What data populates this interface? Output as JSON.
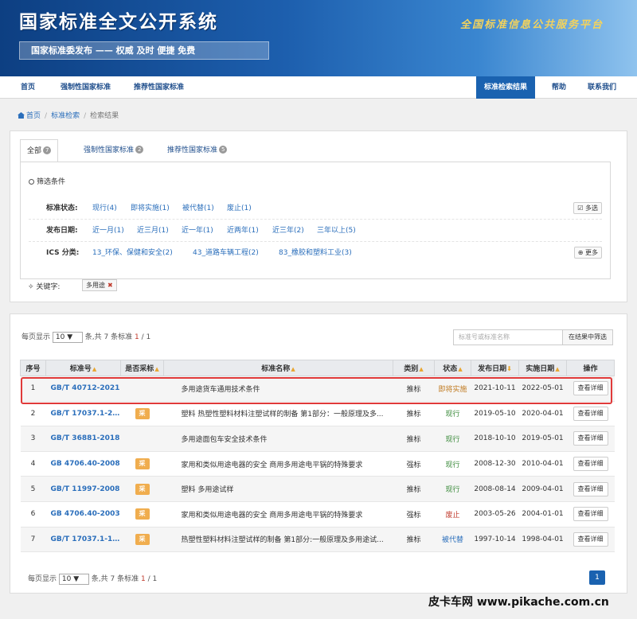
{
  "banner": {
    "title": "国家标准全文公开系统",
    "subtitle": "国家标准委发布  ——  权威  及时  便捷  免费",
    "slogan": "全国标准信息公共服务平台"
  },
  "nav": {
    "home": "首页",
    "mandatory": "强制性国家标准",
    "recommended": "推荐性国家标准",
    "search_results": "标准检索结果",
    "help": "帮助",
    "contact": "联系我们"
  },
  "breadcrumb": [
    "首页",
    "标准检索",
    "检索结果"
  ],
  "tabs": [
    {
      "label": "全部",
      "count": "7"
    },
    {
      "label": "强制性国家标准",
      "count": "2"
    },
    {
      "label": "推荐性国家标准",
      "count": "5"
    }
  ],
  "filters": {
    "title": "筛选条件",
    "status": {
      "label": "标准状态:",
      "options": [
        "现行(4)",
        "即将实施(1)",
        "被代替(1)",
        "废止(1)"
      ],
      "button": "多选"
    },
    "date": {
      "label": "发布日期:",
      "options": [
        "近一月(1)",
        "近三月(1)",
        "近一年(1)",
        "近两年(1)",
        "近三年(2)",
        "三年以上(5)"
      ]
    },
    "ics": {
      "label": "ICS 分类:",
      "options": [
        "13_环保、保健和安全(2)",
        "43_道路车辆工程(2)",
        "83_橡胶和塑料工业(3)"
      ],
      "button": "更多"
    }
  },
  "keyword": {
    "label": "关键字:",
    "value": "多用途",
    "remove": "✖"
  },
  "pagination": {
    "per_page_prefix": "每页显示",
    "per_page_value": "10",
    "per_page_suffix": "条,共 7 条标准",
    "current": "1",
    "total": "/ 1",
    "page_button": "1"
  },
  "search": {
    "placeholder": "标准号或标准名称",
    "button": "在结果中筛选"
  },
  "table": {
    "headers": {
      "no": "序号",
      "code": "标准号",
      "adopt": "是否采标",
      "name": "标准名称",
      "category": "类别",
      "status": "状态",
      "publish": "发布日期",
      "implement": "实施日期",
      "action": "操作"
    },
    "adopt_badge": "采",
    "detail_label": "查看详细",
    "rows": [
      {
        "no": "1",
        "code": "GB/T 40712-2021",
        "adopt": false,
        "name": "多用途货车通用技术条件",
        "category": "推标",
        "status": "即将实施",
        "status_color": "#c07a20",
        "publish": "2021-10-11",
        "implement": "2022-05-01"
      },
      {
        "no": "2",
        "code": "GB/T 17037.1-20...",
        "adopt": true,
        "name": "塑料 热塑性塑料材料注塑试样的制备 第1部分：一般原理及多...",
        "category": "推标",
        "status": "现行",
        "status_color": "#3a8a3a",
        "publish": "2019-05-10",
        "implement": "2020-04-01"
      },
      {
        "no": "3",
        "code": "GB/T 36881-2018",
        "adopt": false,
        "name": "多用途面包车安全技术条件",
        "category": "推标",
        "status": "现行",
        "status_color": "#3a8a3a",
        "publish": "2018-10-10",
        "implement": "2019-05-01"
      },
      {
        "no": "4",
        "code": "GB 4706.40-2008",
        "adopt": true,
        "name": "家用和类似用途电器的安全 商用多用途电平锅的特殊要求",
        "category": "强标",
        "status": "现行",
        "status_color": "#3a8a3a",
        "publish": "2008-12-30",
        "implement": "2010-04-01"
      },
      {
        "no": "5",
        "code": "GB/T 11997-2008",
        "adopt": true,
        "name": "塑料 多用途试样",
        "category": "推标",
        "status": "现行",
        "status_color": "#3a8a3a",
        "publish": "2008-08-14",
        "implement": "2009-04-01"
      },
      {
        "no": "6",
        "code": "GB 4706.40-2003",
        "adopt": true,
        "name": "家用和类似用途电器的安全 商用多用途电平锅的特殊要求",
        "category": "强标",
        "status": "废止",
        "status_color": "#c0392b",
        "publish": "2003-05-26",
        "implement": "2004-01-01"
      },
      {
        "no": "7",
        "code": "GB/T 17037.1-19...",
        "adopt": true,
        "name": "热塑性塑料材料注塑试样的制备 第1部分:一般原理及多用途试...",
        "category": "推标",
        "status": "被代替",
        "status_color": "#2a6ebb",
        "publish": "1997-10-14",
        "implement": "1998-04-01"
      }
    ]
  },
  "watermark": "皮卡车网  www.pikache.com.cn"
}
